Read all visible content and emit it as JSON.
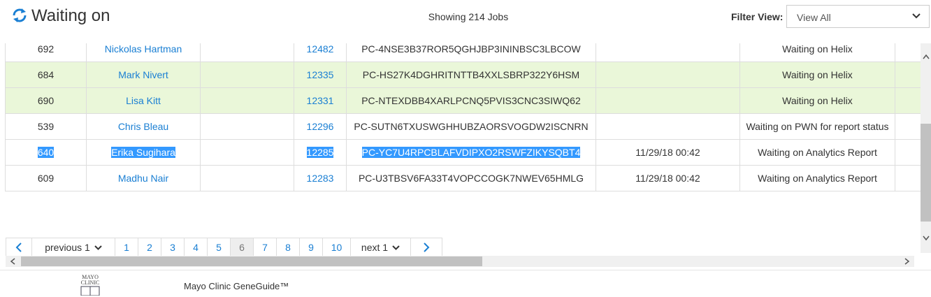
{
  "header": {
    "title": "Waiting on",
    "job_count": "Showing 214 Jobs",
    "filter_label": "Filter View:",
    "filter_value": "View All"
  },
  "rows": [
    {
      "id": "692",
      "name": "Nickolas Hartman",
      "col3": "",
      "num": "12482",
      "code": "PC-4NSE3B37ROR5QGHJBP3ININBSC3LBCOW",
      "date": "",
      "status": "Waiting on Helix",
      "highlight": false,
      "selected": false
    },
    {
      "id": "684",
      "name": "Mark Nivert",
      "col3": "",
      "num": "12335",
      "code": "PC-HS27K4DGHRITNTTB4XXLSBRP322Y6HSM",
      "date": "",
      "status": "Waiting on Helix",
      "highlight": true,
      "selected": false
    },
    {
      "id": "690",
      "name": "Lisa Kitt",
      "col3": "",
      "num": "12331",
      "code": "PC-NTEXDBB4XARLPCNQ5PVIS3CNC3SIWQ62",
      "date": "",
      "status": "Waiting on Helix",
      "highlight": true,
      "selected": false
    },
    {
      "id": "539",
      "name": "Chris Bleau",
      "col3": "",
      "num": "12296",
      "code": "PC-SUTN6TXUSWGHHUBZAORSVOGDW2ISCNRN",
      "date": "",
      "status": "Waiting on PWN for report status",
      "highlight": false,
      "selected": false
    },
    {
      "id": "640",
      "name": "Erika Sugihara",
      "col3": "",
      "num": "12285",
      "code": "PC-YC7U4RPCBLAFVDIPXO2RSWFZIKYSQBT4",
      "date": "11/29/18 00:42",
      "status": "Waiting on Analytics Report",
      "highlight": false,
      "selected": true
    },
    {
      "id": "609",
      "name": "Madhu Nair",
      "col3": "",
      "num": "12283",
      "code": "PC-U3TBSV6FA33T4VOPCCOGK7NWEV65HMLG",
      "date": "11/29/18 00:42",
      "status": "Waiting on Analytics Report",
      "highlight": false,
      "selected": false
    }
  ],
  "pagination": {
    "previous_label": "previous 1",
    "next_label": "next 1",
    "pages": [
      "1",
      "2",
      "3",
      "4",
      "5",
      "6",
      "7",
      "8",
      "9",
      "10"
    ],
    "current_page": "6"
  },
  "footer": {
    "logo_line1": "MAYO",
    "logo_line2": "CLINIC",
    "brand": "Mayo Clinic GeneGuide™"
  },
  "icons": {
    "refresh": "refresh-icon",
    "chevron_down": "chevron-down-icon",
    "prev": "chevron-left-icon",
    "next": "chevron-right-icon"
  },
  "colors": {
    "link": "#1a7fd3",
    "row_highlight": "#eaf7d9",
    "selection": "#3399ff"
  }
}
